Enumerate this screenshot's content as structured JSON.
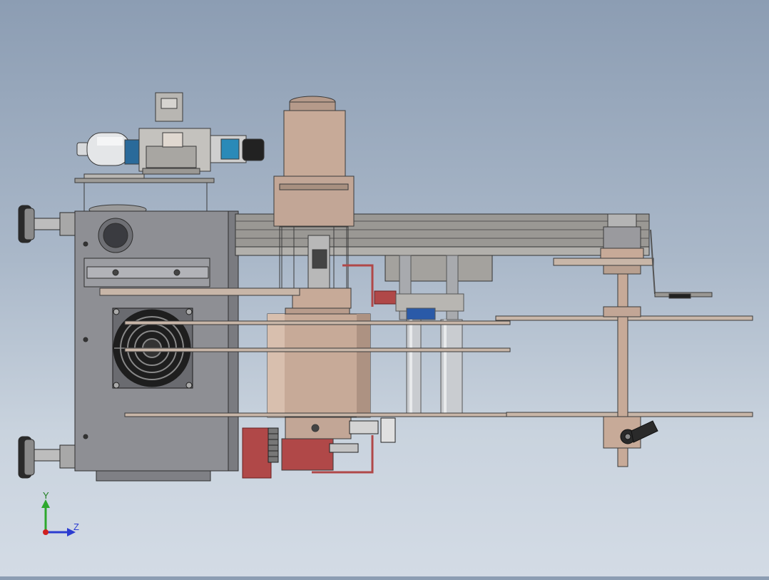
{
  "viewport": {
    "background_top": "#8c9db3",
    "background_bottom": "#d3dbe5"
  },
  "triad": {
    "y_label": "Y",
    "z_label": "Z",
    "y_color": "#2ea82e",
    "z_color": "#2b3cd0",
    "x_color": "#d02020"
  },
  "colors": {
    "housing_gray": "#8e8f94",
    "motor_tan": "#c7aa98",
    "rail_gray": "#9a9894",
    "rod_silver": "#c9ccd0",
    "bracket_red": "#b04848",
    "pad_black": "#2a2a2a",
    "bearing_blue": "#2a5aa8"
  },
  "model": {
    "icons": [
      "control-box",
      "cooling-fan",
      "leveling-feet",
      "solenoid-valve",
      "spindle-motor",
      "linear-rail",
      "guide-rods",
      "turntable-discs",
      "idler-pulley",
      "clamp-lever"
    ]
  }
}
